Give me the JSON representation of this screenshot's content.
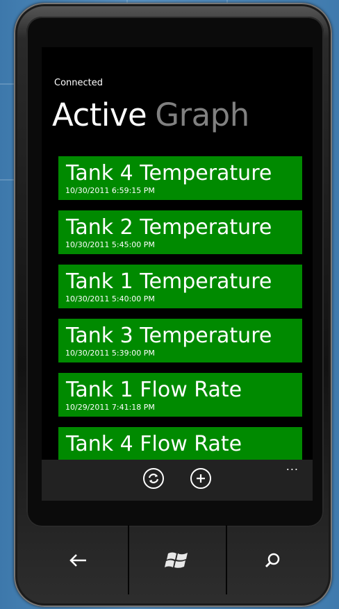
{
  "status_text": "Connected",
  "pivot": {
    "active": "Active",
    "inactive": "Graph"
  },
  "items": [
    {
      "name": "Tank 4 Temperature",
      "timestamp": "10/30/2011 6:59:15 PM"
    },
    {
      "name": "Tank 2 Temperature",
      "timestamp": "10/30/2011 5:45:00 PM"
    },
    {
      "name": "Tank 1 Temperature",
      "timestamp": "10/30/2011 5:40:00 PM"
    },
    {
      "name": "Tank 3 Temperature",
      "timestamp": "10/30/2011 5:39:00 PM"
    },
    {
      "name": "Tank 1 Flow Rate",
      "timestamp": "10/29/2011 7:41:18 PM"
    },
    {
      "name": "Tank 4 Flow Rate",
      "timestamp": ""
    }
  ],
  "app_bar": {
    "buttons": [
      "refresh-icon",
      "add-icon"
    ],
    "more": "..."
  },
  "hardware_buttons": [
    "back-icon",
    "windows-start-icon",
    "search-icon"
  ],
  "colors": {
    "tile": "#008a00",
    "pivot_inactive": "#808080",
    "app_bar": "#222222"
  }
}
